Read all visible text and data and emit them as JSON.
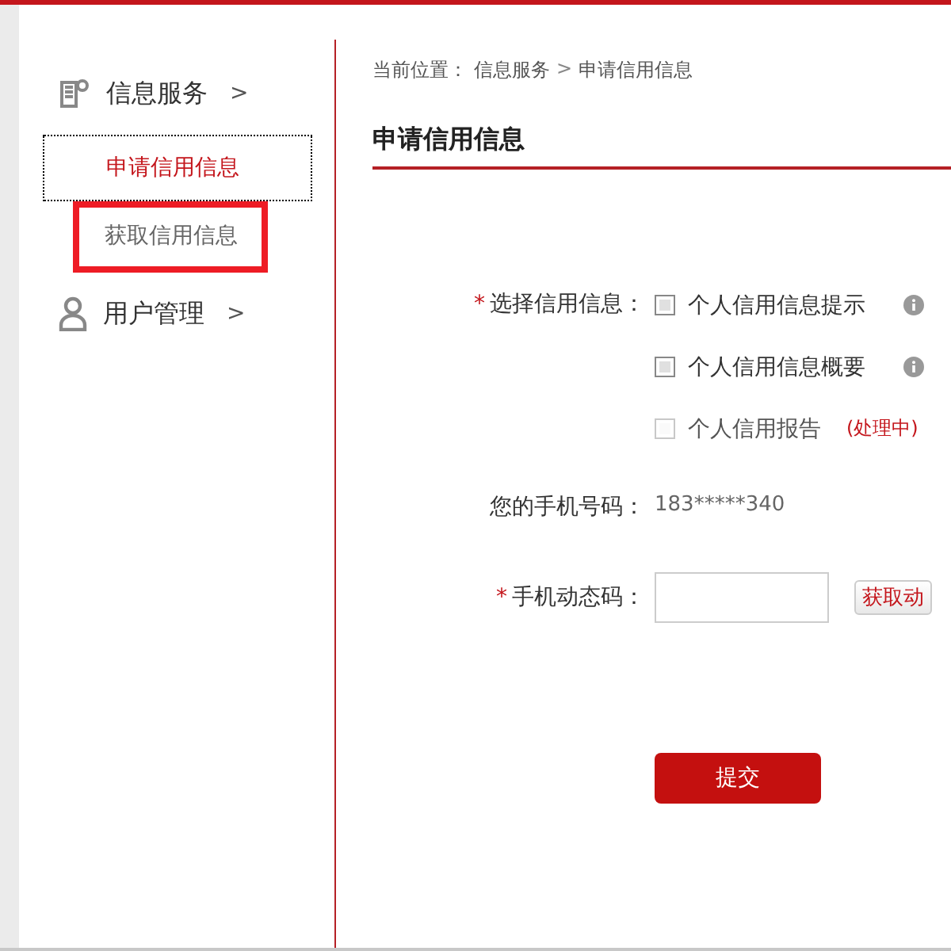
{
  "sidebar": {
    "sections": [
      {
        "kind": "document",
        "label": "信息服务",
        "arrow": ">",
        "items": [
          {
            "label": "申请信用信息",
            "selected": true,
            "highlighted": false
          },
          {
            "label": "获取信用信息",
            "selected": false,
            "highlighted": true
          }
        ]
      },
      {
        "kind": "user",
        "label": "用户管理",
        "arrow": ">"
      }
    ]
  },
  "breadcrumb": {
    "prefix": "当前位置：",
    "parent": "信息服务",
    "separator": ">",
    "current": "申请信用信息"
  },
  "title": "申请信用信息",
  "form": {
    "choice_label": "选择信用信息：",
    "required_mark": "*",
    "options": [
      {
        "label": "个人信用信息提示",
        "checked": false,
        "disabled": false,
        "info": true
      },
      {
        "label": "个人信用信息概要",
        "checked": false,
        "disabled": false,
        "info": true
      },
      {
        "label": "个人信用报告",
        "checked": false,
        "disabled": true,
        "info": false,
        "note": "(处理中)"
      }
    ],
    "phone_label": "您的手机号码：",
    "phone_value": "183*****340",
    "code_label": "手机动态码：",
    "code_button": "获取动",
    "submit": "提交"
  }
}
